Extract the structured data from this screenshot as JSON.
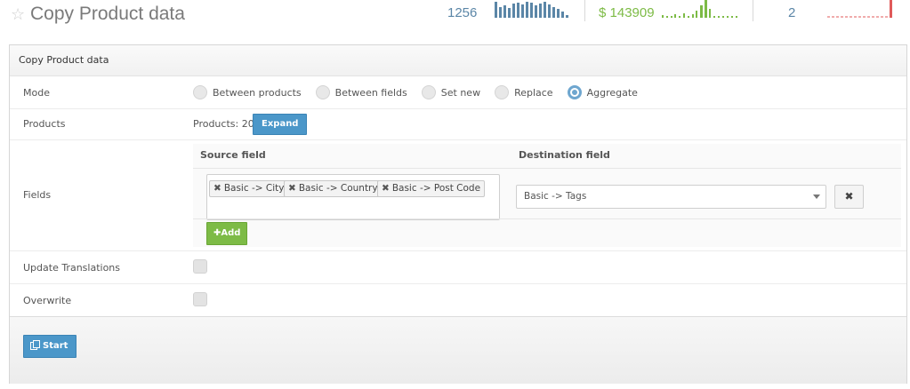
{
  "header": {
    "title": "Copy Product data",
    "stats": [
      {
        "value": "1256",
        "color": "#5b86a7"
      },
      {
        "value": "$ 143909",
        "color": "#7dbb46"
      },
      {
        "value": "2",
        "color": "#e05a5a"
      }
    ]
  },
  "panel": {
    "title": "Copy Product data",
    "mode": {
      "label": "Mode",
      "options": [
        "Between products",
        "Between fields",
        "Set new",
        "Replace",
        "Aggregate"
      ],
      "selected": "Aggregate"
    },
    "products": {
      "label": "Products",
      "count_text": "Products: 20",
      "expand_label": "Expand"
    },
    "fields": {
      "label": "Fields",
      "source_header": "Source field",
      "destination_header": "Destination field",
      "source_tags": [
        "Basic -> City",
        "Basic -> Country",
        "Basic -> Post Code"
      ],
      "destination_value": "Basic -> Tags",
      "remove_label": "✖",
      "add_label": "Add"
    },
    "update_translations": {
      "label": "Update Translations",
      "checked": false
    },
    "overwrite": {
      "label": "Overwrite",
      "checked": false
    },
    "start_label": "Start"
  }
}
